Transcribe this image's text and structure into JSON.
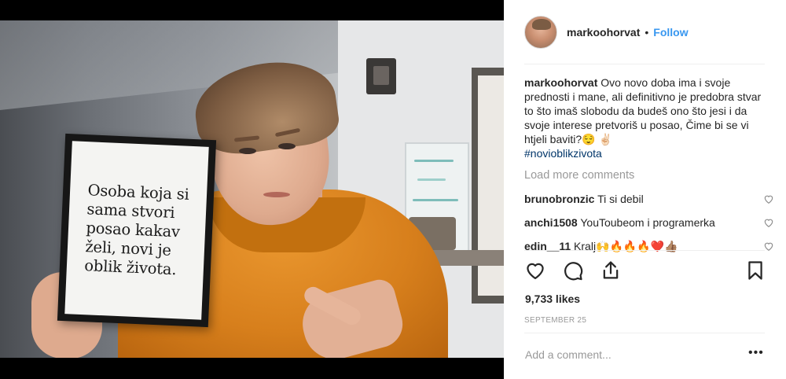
{
  "photo": {
    "sign_lines": [
      "Osoba koja si",
      "sama stvori",
      "posao kakav",
      "želi, novi je",
      "oblik života."
    ]
  },
  "header": {
    "username": "markoohorvat",
    "separator": "•",
    "follow_label": "Follow"
  },
  "caption": {
    "username": "markoohorvat",
    "text": "Ovo novo doba ima i svoje prednosti i mane, ali definitivno je predobra stvar to što imaš slobodu da budeš ono što jesi i da svoje interese pretvoriš u posao, Čime bi se vi htjeli baviti?😌 ✌🏻",
    "hashtag": "#novioblikzivota"
  },
  "load_more": "Load more comments",
  "comments": [
    {
      "username": "brunobronzic",
      "text": "Ti si debil"
    },
    {
      "username": "anchi1508",
      "text": "YouToubeom i programerka"
    },
    {
      "username": "edin__11",
      "text": "Kralj🙌🔥🔥🔥❤️👍🏽"
    }
  ],
  "icons": {
    "like": "heart-icon",
    "comment": "comment-bubble-icon",
    "share": "share-icon",
    "save": "bookmark-icon"
  },
  "likes": "9,733 likes",
  "date": "SEPTEMBER 25",
  "add_comment_placeholder": "Add a comment...",
  "more_options": "•••",
  "colors": {
    "link": "#3897f0",
    "hashtag": "#003569",
    "muted": "#999999",
    "text": "#262626"
  }
}
